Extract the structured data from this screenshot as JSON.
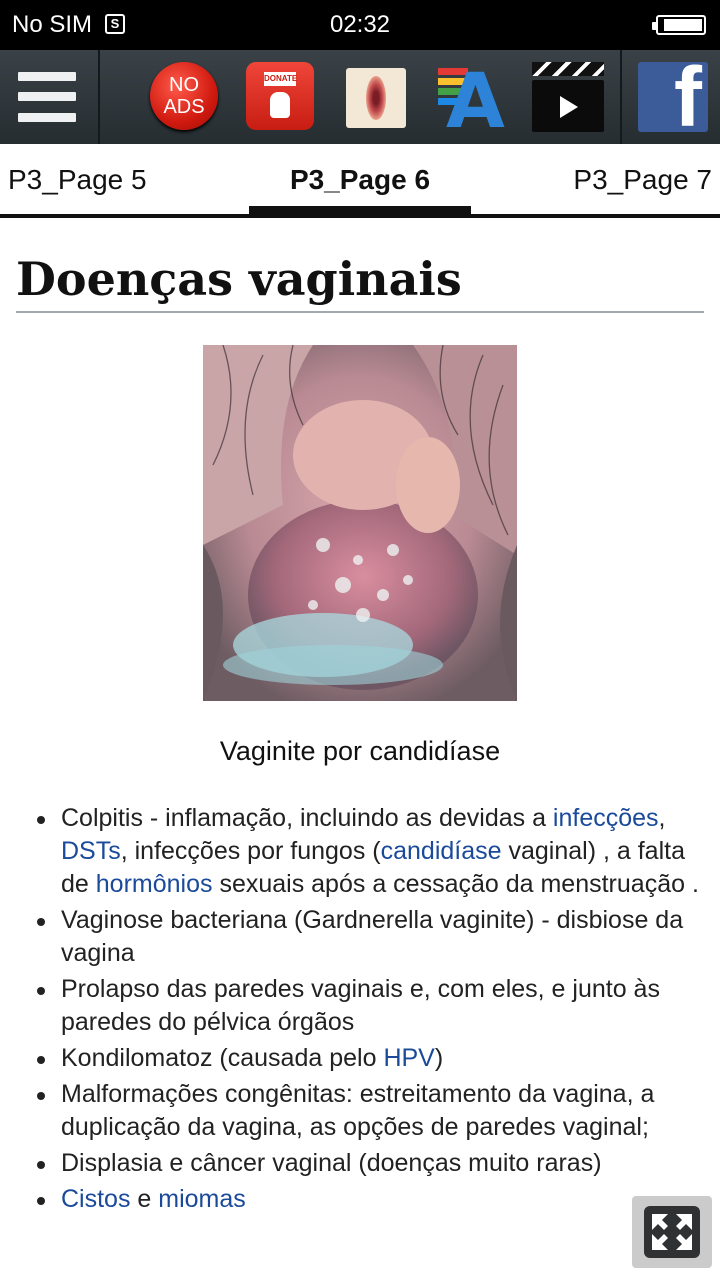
{
  "status_bar": {
    "carrier": "No SIM",
    "sim_icon_label": "S",
    "time": "02:32"
  },
  "toolbar": {
    "no_ads_line1": "NO",
    "no_ads_line2": "ADS",
    "donate_label": "DONATE"
  },
  "tabs": [
    "P3_Page 5",
    "P3_Page 6",
    "P3_Page 7"
  ],
  "selected_tab": "P3_Page 6",
  "article": {
    "title": "Doenças vaginais",
    "image_caption": "Vaginite por candidíase",
    "items": [
      {
        "parts": [
          {
            "text": "Colpitis - inflamação, incluindo as devidas a ",
            "link": false
          },
          {
            "text": "infecções",
            "link": true
          },
          {
            "text": ", ",
            "link": false
          },
          {
            "text": "DSTs",
            "link": true
          },
          {
            "text": ", infecções por fungos (",
            "link": false
          },
          {
            "text": "candidíase",
            "link": true
          },
          {
            "text": " vaginal) , a falta de ",
            "link": false
          },
          {
            "text": "hormônios",
            "link": true
          },
          {
            "text": " sexuais após a cessação da menstruação .",
            "link": false
          }
        ]
      },
      {
        "parts": [
          {
            "text": "Vaginose bacteriana (Gardnerella vaginite) - disbiose da vagina",
            "link": false
          }
        ]
      },
      {
        "parts": [
          {
            "text": "Prolapso das paredes vaginais e, com eles, e junto às paredes do pélvica órgãos",
            "link": false
          }
        ]
      },
      {
        "parts": [
          {
            "text": "Kondilomatoz (causada pelo ",
            "link": false
          },
          {
            "text": "HPV",
            "link": true
          },
          {
            "text": ")",
            "link": false
          }
        ]
      },
      {
        "parts": [
          {
            "text": "Malformações congênitas: estreitamento da vagina, a duplicação da vagina, as opções de paredes vaginal;",
            "link": false
          }
        ]
      },
      {
        "parts": [
          {
            "text": "Displasia e câncer vaginal (doenças muito raras)",
            "link": false
          }
        ]
      },
      {
        "parts": [
          {
            "text": "Cistos",
            "link": true
          },
          {
            "text": " e ",
            "link": false
          },
          {
            "text": "miomas",
            "link": true
          }
        ]
      }
    ]
  },
  "colors": {
    "link": "#1a4a99",
    "toolbar": "#2f363a",
    "facebook": "#3b5b99",
    "no_ads": "#d11a10"
  }
}
